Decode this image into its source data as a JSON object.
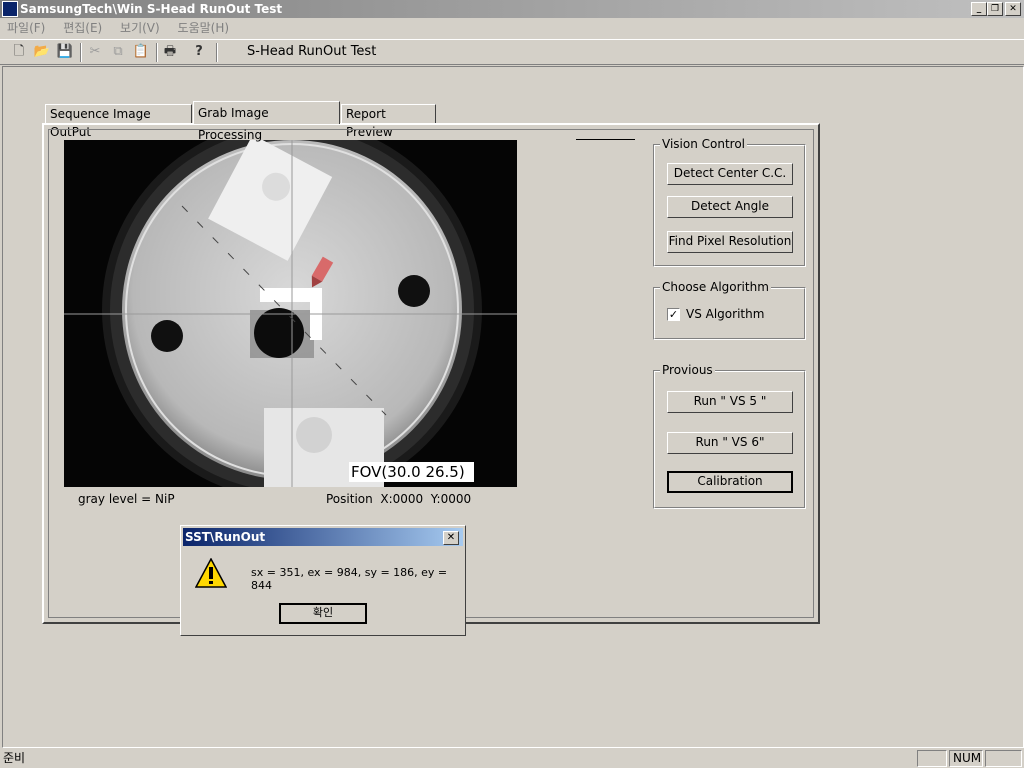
{
  "window": {
    "title": "SamsungTech\\Win S-Head RunOut Test"
  },
  "menu": [
    "파일(F)",
    "편집(E)",
    "보기(V)",
    "도움말(H)"
  ],
  "toolbar": {
    "title": "S-Head RunOut Test"
  },
  "tabs": [
    "Sequence Image OutPut",
    "Grab Image Processing",
    "Report Preview"
  ],
  "image": {
    "overlay": "FOV(30.0 26.5)",
    "gray_level": "gray level = NiP",
    "position": "Position  X:0000  Y:0000"
  },
  "vision_control": {
    "legend": "Vision Control",
    "buttons": [
      "Detect Center C.C.",
      "Detect Angle",
      "Find Pixel Resolution"
    ]
  },
  "choose_algorithm": {
    "legend": "Choose Algorithm",
    "checkbox_label": "VS Algorithm",
    "checked": true
  },
  "provious": {
    "legend": "Provious",
    "buttons": [
      "Run \" VS 5 \"",
      "Run \" VS 6\"",
      "Calibration"
    ]
  },
  "dialog": {
    "title": "SST\\RunOut",
    "message": "sx = 351, ex = 984, sy = 186, ey = 844",
    "ok": "확인"
  },
  "status": {
    "text": "준비",
    "num": "NUM"
  },
  "colors": {
    "title_active": "#0a246a",
    "face": "#d4d0c8"
  },
  "icons": [
    "app-icon",
    "new-icon",
    "open-icon",
    "save-icon",
    "cut-icon",
    "copy-icon",
    "paste-icon",
    "print-icon",
    "help-icon",
    "warning-icon",
    "close-icon"
  ]
}
